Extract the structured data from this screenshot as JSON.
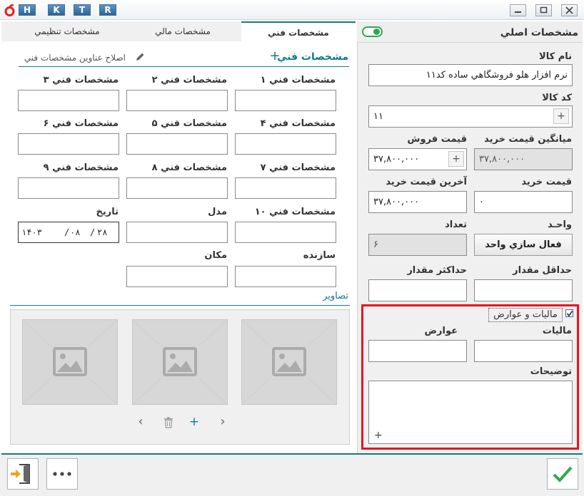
{
  "title_bar": {
    "keys": [
      "H",
      "K",
      "T",
      "R"
    ]
  },
  "tabs": {
    "technical": "مشخصات فني",
    "financial": "مشخصات مالي",
    "settings": "مشخصات تنظيمي"
  },
  "right_panel": {
    "header": "مشخصات اصلي",
    "name_label": "نام كالا",
    "name_value": "نرم افزار هلو فروشگاهي ساده كد۱۱",
    "code_label": "كد كالا",
    "code_value": "۱۱",
    "avg_price_label": "ميانگين قيمت خريد",
    "avg_price_value": "۳۷,۸۰۰,۰۰۰",
    "sale_price_label": "قيمت فروش",
    "sale_price_value": "۳۷,۸۰۰,۰۰۰",
    "buy_price_label": "قيمت خريد",
    "buy_price_value": "۰",
    "last_buy_price_label": "آخرين قيمت خريد",
    "last_buy_price_value": "۳۷,۸۰۰,۰۰۰",
    "unit_label": "واحـد",
    "unit_button": "فعال سازي واحد",
    "count_label": "تعداد",
    "count_value": "۶",
    "min_qty_label": "حداقل مقدار",
    "max_qty_label": "حداكثر مقدار",
    "tax_checkbox_label": "ماليات و عوارض",
    "tax_label": "ماليات",
    "duty_label": "عوارض",
    "description_label": "توضيحات",
    "plus": "+"
  },
  "technical": {
    "section_title": "مشخصات فني",
    "section_plus": "+",
    "edit_link": "اصلاح عناوين مشخصات فني",
    "spec1": "مشخصات فني ۱",
    "spec2": "مشخصات فني ۲",
    "spec3": "مشخصات فني ۳",
    "spec4": "مشخصات فني ۴",
    "spec5": "مشخصات فني ۵",
    "spec6": "مشخصات فني ۶",
    "spec7": "مشخصات فني ۷",
    "spec8": "مشخصات فني ۸",
    "spec9": "مشخصات فني ۹",
    "spec10": "مشخصات فني ۱۰",
    "model_label": "مدل",
    "date_label": "تاريخ",
    "date_year": "۱۴۰۳",
    "date_month": "۰۸",
    "date_day": "۲۸",
    "date_sep": "/",
    "maker_label": "سازنده",
    "place_label": "مكان",
    "images_title": "تصاوير",
    "plus": "+",
    "prev": "‹",
    "next": "›"
  },
  "colors": {
    "accent": "#117a8b",
    "highlight_border": "#e8141e",
    "toggle": "#2ea84f",
    "confirm": "#2fa84f",
    "exit_arrow": "#f0a417"
  }
}
